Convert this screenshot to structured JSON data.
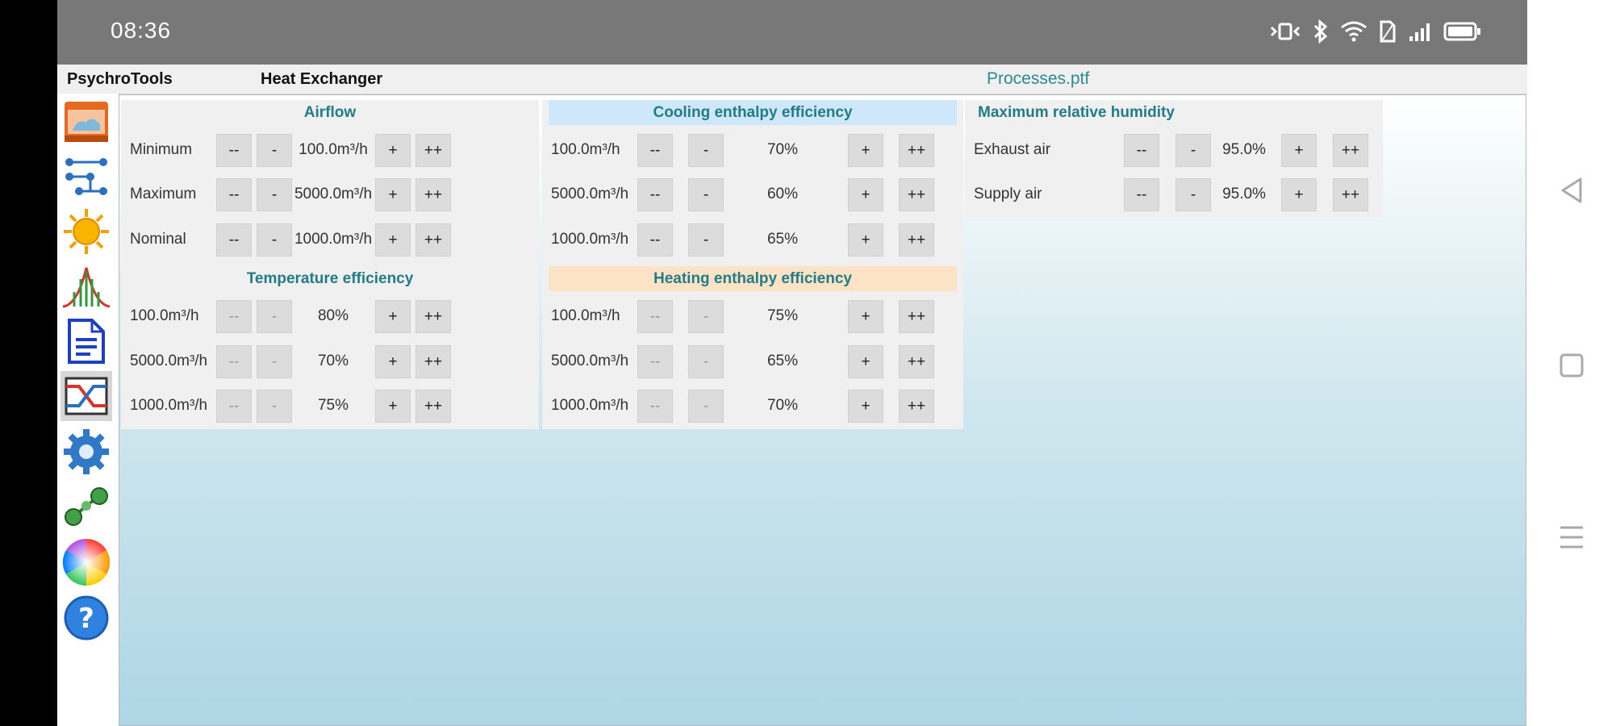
{
  "status_bar": {
    "time": "08:36"
  },
  "app": {
    "title": "PsychroTools",
    "page_title": "Heat Exchanger",
    "file_name": "Processes.ptf"
  },
  "sidebar": {
    "items": [
      {
        "icon": "home-icon"
      },
      {
        "icon": "flow-icon"
      },
      {
        "icon": "sun-icon"
      },
      {
        "icon": "chart-icon"
      },
      {
        "icon": "document-icon"
      },
      {
        "icon": "heat-exchanger-icon"
      },
      {
        "icon": "gear-icon"
      },
      {
        "icon": "link-icon"
      },
      {
        "icon": "color-wheel-icon"
      },
      {
        "icon": "help-icon"
      }
    ]
  },
  "buttons": {
    "dec2": "--",
    "dec1": "-",
    "inc1": "+",
    "inc2": "++"
  },
  "airflow": {
    "title": "Airflow",
    "rows": [
      {
        "label": "Minimum",
        "value": "100.0m³/h"
      },
      {
        "label": "Maximum",
        "value": "5000.0m³/h"
      },
      {
        "label": "Nominal",
        "value": "1000.0m³/h"
      }
    ]
  },
  "temperature_efficiency": {
    "title": "Temperature efficiency",
    "rows": [
      {
        "label": "100.0m³/h",
        "value": "80%"
      },
      {
        "label": "5000.0m³/h",
        "value": "70%"
      },
      {
        "label": "1000.0m³/h",
        "value": "75%"
      }
    ]
  },
  "cooling_enthalpy": {
    "title": "Cooling enthalpy efficiency",
    "rows": [
      {
        "label": "100.0m³/h",
        "value": "70%"
      },
      {
        "label": "5000.0m³/h",
        "value": "60%"
      },
      {
        "label": "1000.0m³/h",
        "value": "65%"
      }
    ]
  },
  "heating_enthalpy": {
    "title": "Heating enthalpy efficiency",
    "rows": [
      {
        "label": "100.0m³/h",
        "value": "75%"
      },
      {
        "label": "5000.0m³/h",
        "value": "65%"
      },
      {
        "label": "1000.0m³/h",
        "value": "70%"
      }
    ]
  },
  "max_humidity": {
    "title": "Maximum relative humidity",
    "rows": [
      {
        "label": "Exhaust air",
        "value": "95.0%"
      },
      {
        "label": "Supply air",
        "value": "95.0%"
      }
    ]
  }
}
